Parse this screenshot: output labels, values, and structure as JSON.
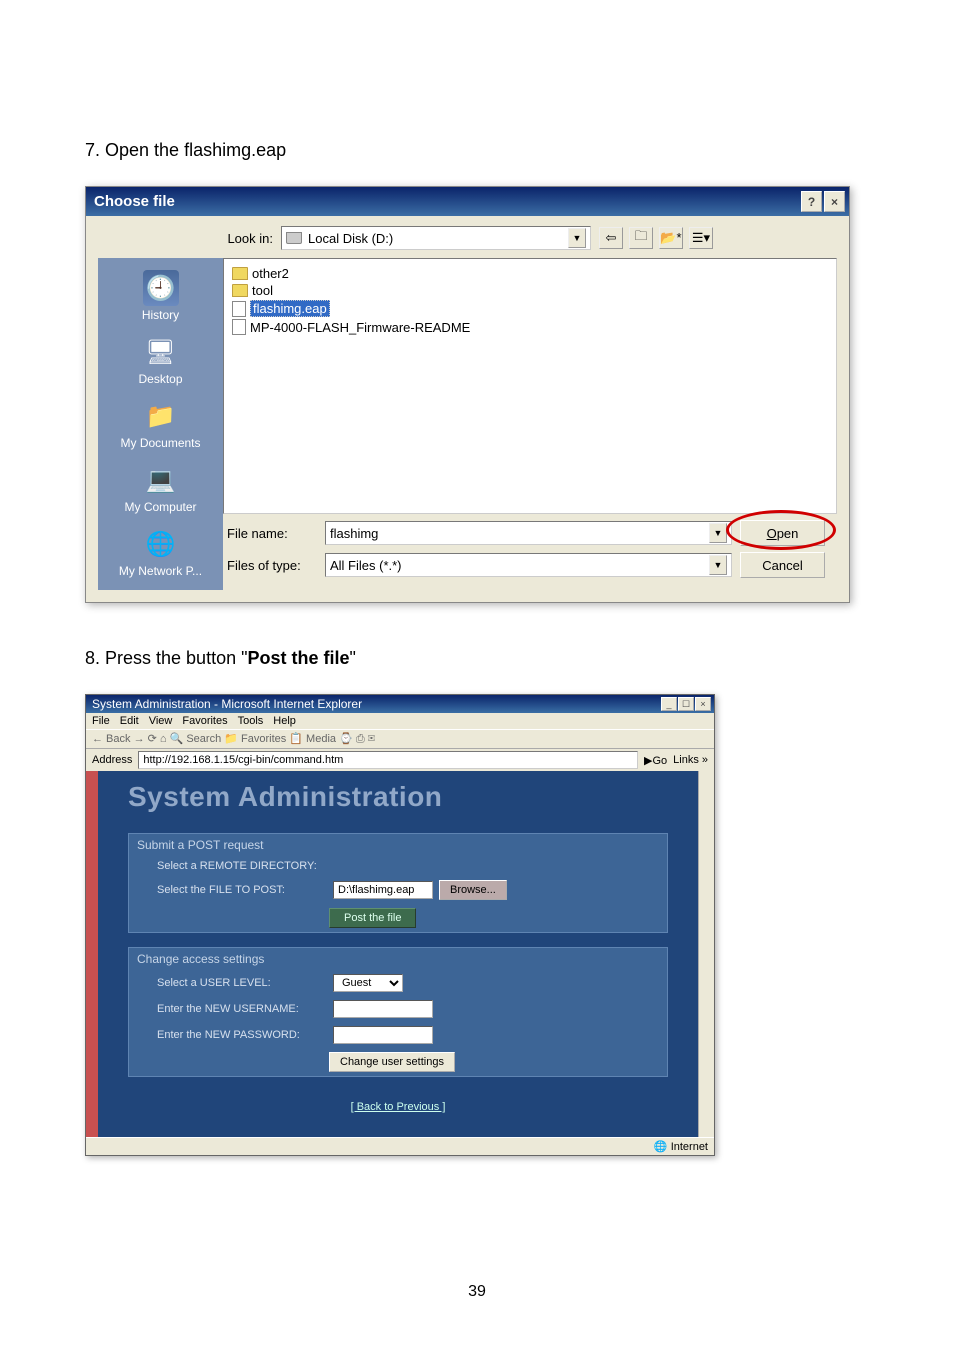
{
  "step7_text": "7. Open the flashimg.eap",
  "step8_text_prefix": "8. Press the button \"",
  "step8_bold": "Post the file",
  "step8_text_suffix": "\"",
  "page_number": "39",
  "dialog1": {
    "title": "Choose file",
    "help_btn": "?",
    "close_btn": "×",
    "lookin_label": "Look in:",
    "lookin_value": "Local Disk (D:)",
    "files": [
      {
        "name": "other2",
        "type": "folder"
      },
      {
        "name": "tool",
        "type": "folder"
      },
      {
        "name": "flashimg.eap",
        "type": "file",
        "selected": true
      },
      {
        "name": "MP-4000-FLASH_Firmware-README",
        "type": "file"
      }
    ],
    "places": [
      {
        "label": "History"
      },
      {
        "label": "Desktop"
      },
      {
        "label": "My Documents"
      },
      {
        "label": "My Computer"
      },
      {
        "label": "My Network P..."
      }
    ],
    "filename_label": "File name:",
    "filename_value": "flashimg",
    "filetype_label": "Files of type:",
    "filetype_value": "All Files (*.*)",
    "open_btn": "Open",
    "cancel_btn": "Cancel"
  },
  "dialog2": {
    "title": "System Administration - Microsoft Internet Explorer",
    "menu": [
      "File",
      "Edit",
      "View",
      "Favorites",
      "Tools",
      "Help"
    ],
    "toolbar": "← Back  →  ⟳  ⌂  🔍 Search  📁 Favorites  📋 Media  ⌚  ⎙  ✉",
    "address_label": "Address",
    "address_value": "http://192.168.1.15/cgi-bin/command.htm",
    "go": "Go",
    "links": "Links »",
    "sys_title": "System Administration",
    "panel1": {
      "title": "Submit a POST request",
      "sub1": "Select a REMOTE DIRECTORY:",
      "sub2": "Select the FILE TO POST:",
      "file_input": "D:\\flashimg.eap",
      "browse_btn": "Browse...",
      "post_btn": "Post the file"
    },
    "panel2": {
      "title": "Change access settings",
      "sub1": "Select a USER LEVEL:",
      "level_value": "Guest",
      "sub2": "Enter the NEW USERNAME:",
      "sub3": "Enter the NEW PASSWORD:",
      "change_btn": "Change user settings"
    },
    "back_link": "[ Back to Previous ]",
    "status": "Internet"
  }
}
